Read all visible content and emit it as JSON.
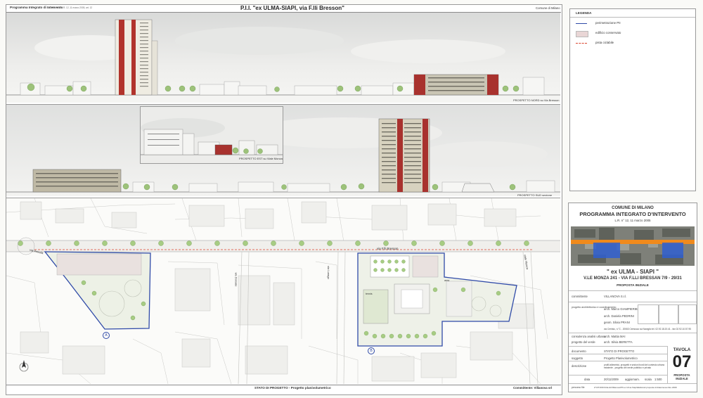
{
  "header": {
    "left_title": "Programma Integrato di Intervento",
    "left_sub": "ai sensi della L.R. 12, 11 marzo 2005, art. 12",
    "center_title": "P.I.I. \"ex ULMA-SIAPI, via F.lli Bresson\"",
    "right_label": "Comune di Milano"
  },
  "elevations": {
    "north_label": "PROSPETTO NORD su Via Bresson",
    "east_label": "PROSPETTO EST su Viale Monza",
    "south_label": "PROSPETTO SUD sezione"
  },
  "plan": {
    "street_labels": {
      "bresson": "via F.lli Bresson",
      "petrella": "via Petrella",
      "dorsale": "via Dorsale",
      "lurago": "via Lurago",
      "monza": "viale Monza"
    },
    "marker_a": "A",
    "marker_b": "B",
    "label_tennis": "tennis",
    "label_area": "area"
  },
  "footer": {
    "center": "STATO DI PROGETTO - Progetto planivolumetrico",
    "right": "Committente: Villanova srl"
  },
  "legend": {
    "title": "LEGENDA",
    "items": [
      {
        "label": "perimetrazione PII",
        "color": "#2f4aa8"
      },
      {
        "label": "edificio conservato",
        "color": "#e9d6d6"
      },
      {
        "label": "pista ciclabile",
        "color": "#d9462f"
      }
    ]
  },
  "title_block": {
    "comune": "COMUNE DI MILANO",
    "programma": "PROGRAMMA INTEGRATO D'INTERVENTO",
    "lr": "L.R. n° 12, 11 marzo 2005",
    "project": "\" ex ULMA - SIAPI \"",
    "address": "V.LE MONZA 241 - VIA F.LLI BRESSAN 7/9 - 29/31",
    "proposta": "PROPOSTA INIZIALE"
  },
  "info": {
    "committente_label": "committente",
    "committente_value": "VILLANOVA S.r.l.",
    "progetto_label": "progetto architettonico e coordinamento",
    "arch1": "arch. Marco GIAMPIERIBINO",
    "arch2": "arch. Daniela PEDRINI",
    "geom": "geom. Silvia PRANI",
    "address_line": "via Cerrisio, n.°C - 20063 Cernusco sul Naviglio tel. 02.92.18.20.41 - fax 02.92.10.57.95",
    "consulenza_label": "consulenza analisi urbana",
    "consulenza_value": "arch. Mattia MAI",
    "verde_label": "progetto del verde",
    "verde_value": "arch. Silvia BERETTA",
    "documento_label": "documento",
    "documento_value": "STATO DI PROGETTO",
    "soggetto_label": "soggetto",
    "soggetto_value": "Progetto Planivolumetrico",
    "descrizione_label": "descrizione",
    "descrizione_value": "profili altimetrici, prospetti e sezioni bordi del contesto urbano esistente - progetto del verde pubblico e privato",
    "data_label": "data",
    "data_value": "20/11/2009",
    "aggiorn_label": "aggiornam.",
    "scala_label": "scala",
    "scala_value": "1:500",
    "percorso_label": "percorso file",
    "percorso_value": "Z:\\STUDIO\\Clienti\\Villanova\\PII ex Ulma Siapi\\Elaborati proposta iniziale\\novembre 2009"
  },
  "tavola": {
    "label": "TAVOLA",
    "number": "07",
    "sub": "PROPOSTA INIZIALE"
  },
  "colors": {
    "perimeter": "#2f4aa8",
    "cycle": "#d9462f",
    "tower_red": "#a8322e",
    "tree": "#8fbf6a",
    "orange_band": "#f08a1c"
  }
}
